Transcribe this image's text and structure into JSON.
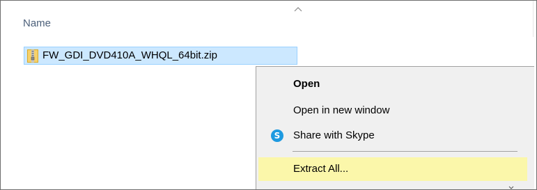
{
  "list": {
    "columns": [
      {
        "label": "Name",
        "sort": "ascending"
      }
    ],
    "files": [
      {
        "name": "FW_GDI_DVD410A_WHQL_64bit.zip",
        "icon": "zip-folder-icon",
        "selected": true
      }
    ]
  },
  "context_menu": {
    "items": [
      {
        "label": "Open",
        "bold": true
      },
      {
        "label": "Open in new window"
      },
      {
        "label": "Share with Skype",
        "icon": "skype-icon"
      },
      {
        "label": "Extract All...",
        "highlighted": true
      }
    ],
    "skype_icon_letter": "S"
  },
  "colors": {
    "selection_bg": "#cce8ff",
    "selection_border": "#99d1ff",
    "menu_bg": "#f0f0f0",
    "highlight_bg": "#fbf7aa",
    "skype_blue": "#1e9ae0",
    "header_text": "#4c607a"
  }
}
